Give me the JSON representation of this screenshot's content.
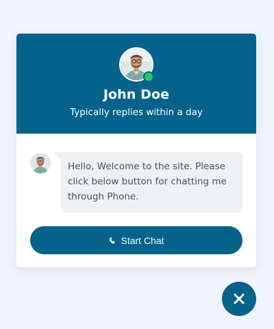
{
  "header": {
    "agent_name": "John Doe",
    "status_text": "Typically replies within a day",
    "avatar_icon": "person-avatar",
    "online_indicator_color": "#2ac36b"
  },
  "message": {
    "text": "Hello, Welcome to the site. Please click below button for chatting me through Phone."
  },
  "actions": {
    "start_chat_label": "Start Chat",
    "start_chat_icon": "phone-icon",
    "close_icon": "close-icon"
  },
  "colors": {
    "brand": "#05628a",
    "background": "#f1f4fd",
    "bubble": "#eff0f2"
  }
}
